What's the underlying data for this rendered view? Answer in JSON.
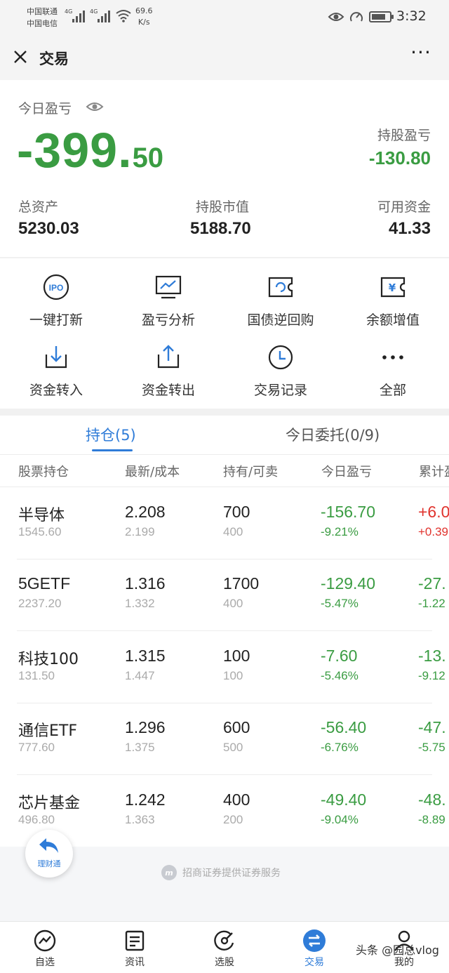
{
  "status_bar": {
    "carrier1": "中国联通",
    "carrier2": "中国电信",
    "net1": "4G",
    "net2": "4G",
    "speed_value": "69.6",
    "speed_unit": "K/s",
    "time": "3:32",
    "battery_level": 0.8
  },
  "nav": {
    "title": "交易",
    "more": "···"
  },
  "summary": {
    "today_pl_label": "今日盈亏",
    "today_pl_int": "-399.",
    "today_pl_dec": "50",
    "holding_pl_label": "持股盈亏",
    "holding_pl_value": "-130.80",
    "total_assets_label": "总资产",
    "total_assets_value": "5230.03",
    "market_value_label": "持股市值",
    "market_value_value": "5188.70",
    "available_label": "可用资金",
    "available_value": "41.33"
  },
  "quick_actions": [
    {
      "label": "一键打新",
      "icon": "ipo-icon"
    },
    {
      "label": "盈亏分析",
      "icon": "chart-monitor-icon"
    },
    {
      "label": "国债逆回购",
      "icon": "ticket-refresh-icon"
    },
    {
      "label": "余额增值",
      "icon": "yen-ticket-icon"
    },
    {
      "label": "资金转入",
      "icon": "transfer-in-icon"
    },
    {
      "label": "资金转出",
      "icon": "transfer-out-icon"
    },
    {
      "label": "交易记录",
      "icon": "clock-icon"
    },
    {
      "label": "全部",
      "icon": "more-dots-icon"
    }
  ],
  "tabs": [
    {
      "label": "持仓(5)",
      "active": true
    },
    {
      "label": "今日委托(0/9)",
      "active": false
    }
  ],
  "table": {
    "headers": [
      "股票持仓",
      "最新/成本",
      "持有/可卖",
      "今日盈亏",
      "累计盈亏"
    ],
    "rows": [
      {
        "name": "半导体",
        "mv": "1545.60",
        "latest": "2.208",
        "cost": "2.199",
        "hold": "700",
        "sellable": "400",
        "today_pl": "-156.70",
        "today_pct": "-9.21%",
        "total_pl": "+6.0",
        "total_pct": "+0.39"
      },
      {
        "name": "5GETF",
        "mv": "2237.20",
        "latest": "1.316",
        "cost": "1.332",
        "hold": "1700",
        "sellable": "400",
        "today_pl": "-129.40",
        "today_pct": "-5.47%",
        "total_pl": "-27.",
        "total_pct": "-1.22"
      },
      {
        "name": "科技100",
        "mv": "131.50",
        "latest": "1.315",
        "cost": "1.447",
        "hold": "100",
        "sellable": "100",
        "today_pl": "-7.60",
        "today_pct": "-5.46%",
        "total_pl": "-13.",
        "total_pct": "-9.12"
      },
      {
        "name": "通信ETF",
        "mv": "777.60",
        "latest": "1.296",
        "cost": "1.375",
        "hold": "600",
        "sellable": "500",
        "today_pl": "-56.40",
        "today_pct": "-6.76%",
        "total_pl": "-47.",
        "total_pct": "-5.75"
      },
      {
        "name": "芯片基金",
        "mv": "496.80",
        "latest": "1.242",
        "cost": "1.363",
        "hold": "400",
        "sellable": "200",
        "today_pl": "-49.40",
        "today_pct": "-9.04%",
        "total_pl": "-48.",
        "total_pct": "-8.89"
      }
    ]
  },
  "footer_note": "招商证券提供证券服务",
  "footer_logo": "m",
  "float_button": {
    "label": "理财通"
  },
  "bottom_nav": [
    {
      "label": "自选",
      "icon": "watchlist-icon",
      "active": false
    },
    {
      "label": "资讯",
      "icon": "news-icon",
      "active": false
    },
    {
      "label": "选股",
      "icon": "stock-picker-icon",
      "active": false
    },
    {
      "label": "交易",
      "icon": "trade-icon",
      "active": true
    },
    {
      "label": "我的",
      "icon": "profile-icon",
      "active": false
    }
  ],
  "watermark": "头条 @园总vlog",
  "colors": {
    "gain": "#e0332d",
    "loss": "#3a9c42",
    "accent": "#2f7cd8"
  }
}
